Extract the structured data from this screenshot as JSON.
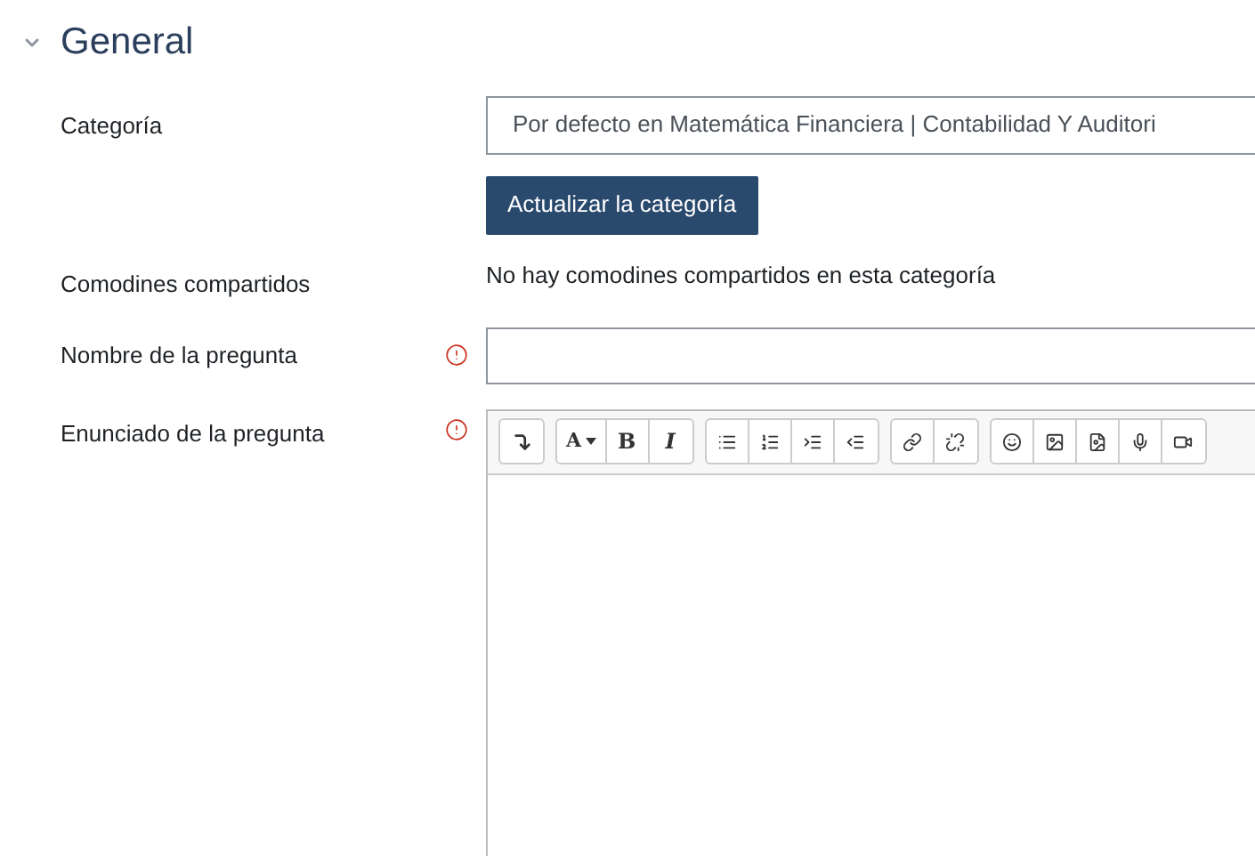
{
  "section": {
    "title": "General",
    "expanded": true
  },
  "category": {
    "label": "Categoría",
    "value": "Por defecto en Matemática Financiera | Contabilidad Y Auditori",
    "button": "Actualizar la categoría"
  },
  "shared_wildcards": {
    "label": "Comodines compartidos",
    "value": "No hay comodines compartidos en esta categoría"
  },
  "question_name": {
    "label": "Nombre de la pregunta",
    "required": true
  },
  "question_text": {
    "label": "Enunciado de la pregunta",
    "required": true,
    "toolbar": {
      "font": "A",
      "bold": "B",
      "italic": "I"
    }
  }
}
